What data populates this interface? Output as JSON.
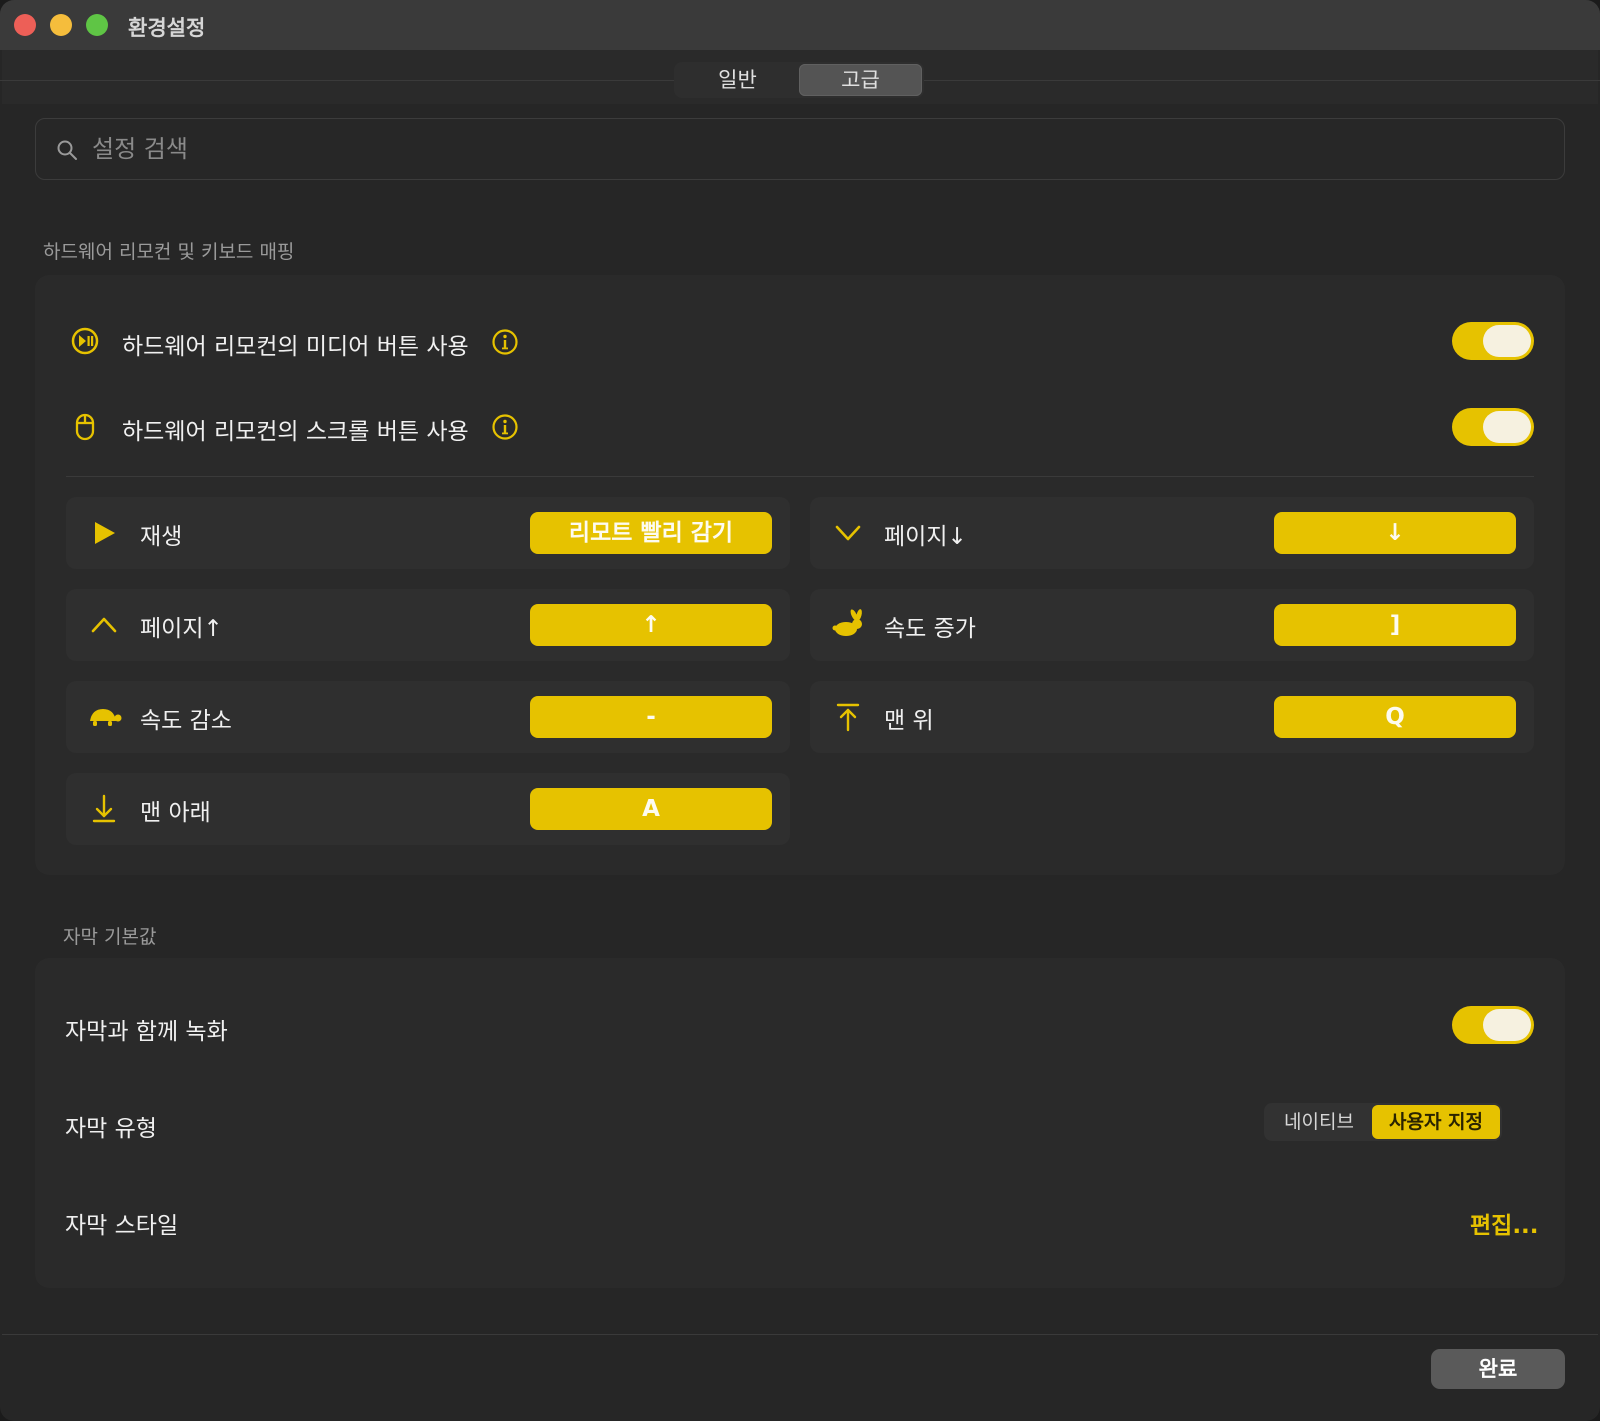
{
  "window": {
    "title": "환경설정"
  },
  "tabs": [
    {
      "label": "일반",
      "active": false
    },
    {
      "label": "고급",
      "active": true
    }
  ],
  "search": {
    "placeholder": "설정 검색",
    "value": ""
  },
  "hardware": {
    "section_title": "하드웨어 리모컨 및 키보드 매핑",
    "media_buttons": {
      "label": "하드웨어 리모컨의 미디어 버튼 사용",
      "enabled": true
    },
    "scroll_buttons": {
      "label": "하드웨어 리모컨의 스크롤 버튼 사용",
      "enabled": true
    },
    "mappings": [
      {
        "label": "재생",
        "key": "리모트 빨리 감기",
        "icon": "play-icon"
      },
      {
        "label": "페이지↓",
        "key": "↓",
        "icon": "chevron-down-icon"
      },
      {
        "label": "페이지↑",
        "key": "↑",
        "icon": "chevron-up-icon"
      },
      {
        "label": "속도 증가",
        "key": "]",
        "icon": "rabbit-icon"
      },
      {
        "label": "속도 감소",
        "key": "-",
        "icon": "turtle-icon"
      },
      {
        "label": "맨 위",
        "key": "Q",
        "icon": "arrow-to-top-icon"
      },
      {
        "label": "맨 아래",
        "key": "A",
        "icon": "arrow-to-bottom-icon"
      }
    ]
  },
  "captions": {
    "section_title": "자막 기본값",
    "record_with_captions": {
      "label": "자막과 함께 녹화",
      "enabled": true
    },
    "caption_type": {
      "label": "자막 유형",
      "options": [
        "네이티브",
        "사용자 지정"
      ],
      "selected": "사용자 지정"
    },
    "caption_style": {
      "label": "자막 스타일",
      "edit_label": "편집..."
    }
  },
  "footer": {
    "done_label": "완료"
  },
  "colors": {
    "accent": "#e6c200",
    "background": "#262626",
    "panel": "#2a2a2a"
  }
}
